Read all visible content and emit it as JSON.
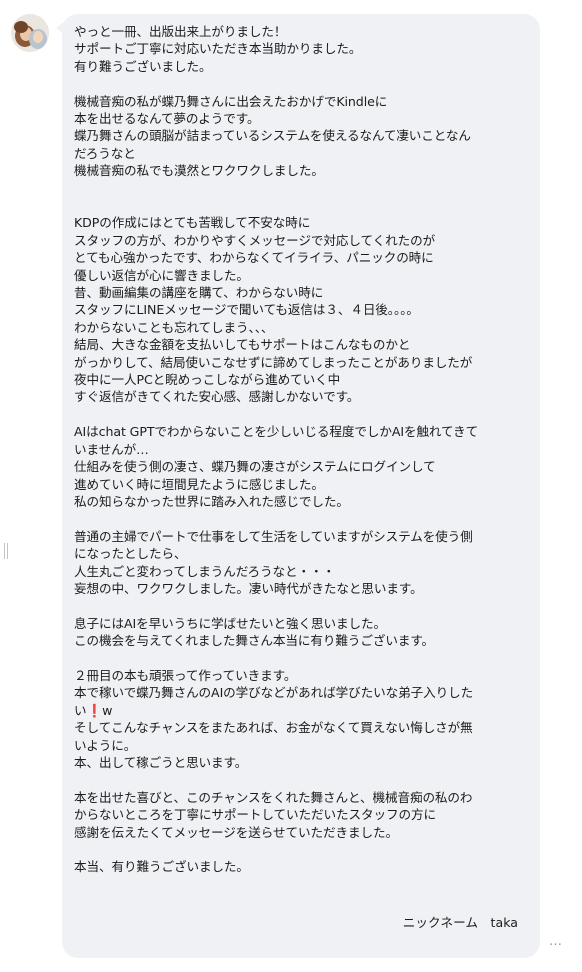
{
  "message": {
    "lines": [
      "やっと一冊、出版出来上がりました！",
      "サポートご丁寧に対応いただき本当助かりました。",
      "有り難うございました。",
      "",
      "機械音痴の私が蝶乃舞さんに出会えたおかげでKindleに",
      "本を出せるなんて夢のようです。",
      "蝶乃舞さんの頭脳が詰まっているシステムを使えるなんて凄いことなん",
      "だろうなと",
      "機械音痴の私でも漠然とワクワクしました。",
      "",
      "",
      "KDPの作成にはとても苦戦して不安な時に",
      "スタッフの方が、わかりやすくメッセージで対応してくれたのが",
      "とても心強かったです、わからなくてイライラ、パニックの時に",
      "優しい返信が心に響きました。",
      "昔、動画編集の講座を購て、わからない時に",
      "スタッフにLINEメッセージで聞いても返信は３、４日後。。。。",
      "わからないことも忘れてしまう、、、",
      "結局、大きな金額を支払いしてもサポートはこんなものかと",
      "がっかりして、結局使いこなせずに諦めてしまったことがありましたが",
      "夜中に一人PCと睨めっこしながら進めていく中",
      "すぐ返信がきてくれた安心感、感謝しかないです。",
      "",
      "AIはchat GPTでわからないことを少しいじる程度でしかAIを触れてきて",
      "いませんが…",
      "仕組みを使う側の凄さ、蝶乃舞の凄さがシステムにログインして",
      "進めていく時に垣間見たように感じました。",
      "私の知らなかった世界に踏み入れた感じでした。",
      "",
      "普通の主婦でパートで仕事をして生活をしていますがシステムを使う側",
      "になったとしたら、",
      "人生丸ごと変わってしまうんだろうなと・・・",
      "妄想の中、ワクワクしました。凄い時代がきたなと思います。",
      "",
      "息子にはAIを早いうちに学ばせたいと強く思いました。",
      "この機会を与えてくれました舞さん本当に有り難うございます。",
      "",
      "２冊目の本も頑張って作っていきます。",
      "本で稼いで蝶乃舞さんのAIの学びなどがあれば学びたいな弟子入りした",
      "い❗w",
      "そしてこんなチャンスをまたあれば、お金がなくて買えない悔しさが無",
      "いように。",
      "本、出して稼ごうと思います。",
      "",
      "本を出せた喜びと、このチャンスをくれた舞さんと、機械音痴の私のわ",
      "からないところを丁寧にサポートしていただいたスタッフの方に",
      "感謝を伝えたくてメッセージを送らせていただきました。",
      "",
      "本当、有り難うございました。"
    ],
    "signature": "ニックネーム　taka"
  },
  "ui": {
    "more_dots": "…",
    "bubble_color": "#f0f1f4",
    "avatar_icon": "user-avatar-photo",
    "more_icon": "more-options-dots-icon",
    "handle_icon": "resize-handle-icon"
  }
}
